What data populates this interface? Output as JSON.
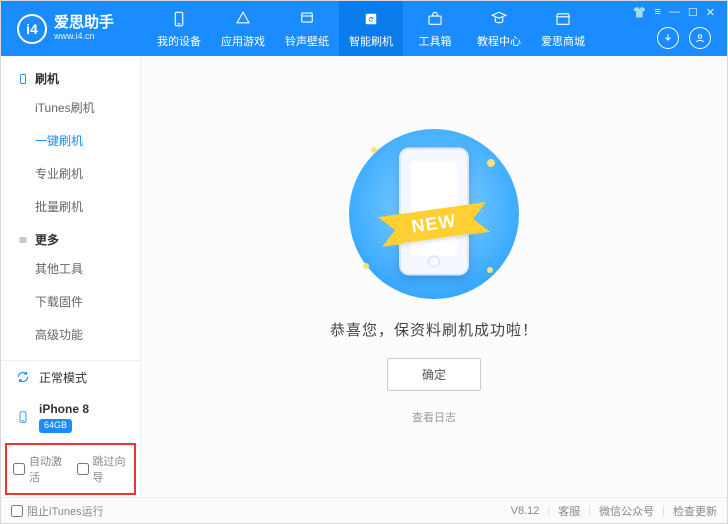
{
  "brand": {
    "name": "爱思助手",
    "url": "www.i4.cn",
    "mark": "i4"
  },
  "nav": {
    "items": [
      {
        "label": "我的设备"
      },
      {
        "label": "应用游戏"
      },
      {
        "label": "铃声壁纸"
      },
      {
        "label": "智能刷机"
      },
      {
        "label": "工具箱"
      },
      {
        "label": "教程中心"
      },
      {
        "label": "爱思商城"
      }
    ]
  },
  "sidebar": {
    "section1": {
      "title": "刷机"
    },
    "items1": [
      {
        "label": "iTunes刷机"
      },
      {
        "label": "一键刷机"
      },
      {
        "label": "专业刷机"
      },
      {
        "label": "批量刷机"
      }
    ],
    "section2": {
      "title": "更多"
    },
    "items2": [
      {
        "label": "其他工具"
      },
      {
        "label": "下载固件"
      },
      {
        "label": "高级功能"
      }
    ],
    "mode": {
      "label": "正常模式"
    },
    "device": {
      "name": "iPhone 8",
      "storage": "64GB"
    },
    "checks": {
      "auto_activate": "自动激活",
      "skip_guide": "跳过向导"
    }
  },
  "main": {
    "ribbon": "NEW",
    "message": "恭喜您，保资料刷机成功啦！",
    "ok": "确定",
    "log": "查看日志"
  },
  "footer": {
    "block_itunes": "阻止iTunes运行",
    "version": "V8.12",
    "links": [
      "客服",
      "微信公众号",
      "检查更新"
    ]
  }
}
